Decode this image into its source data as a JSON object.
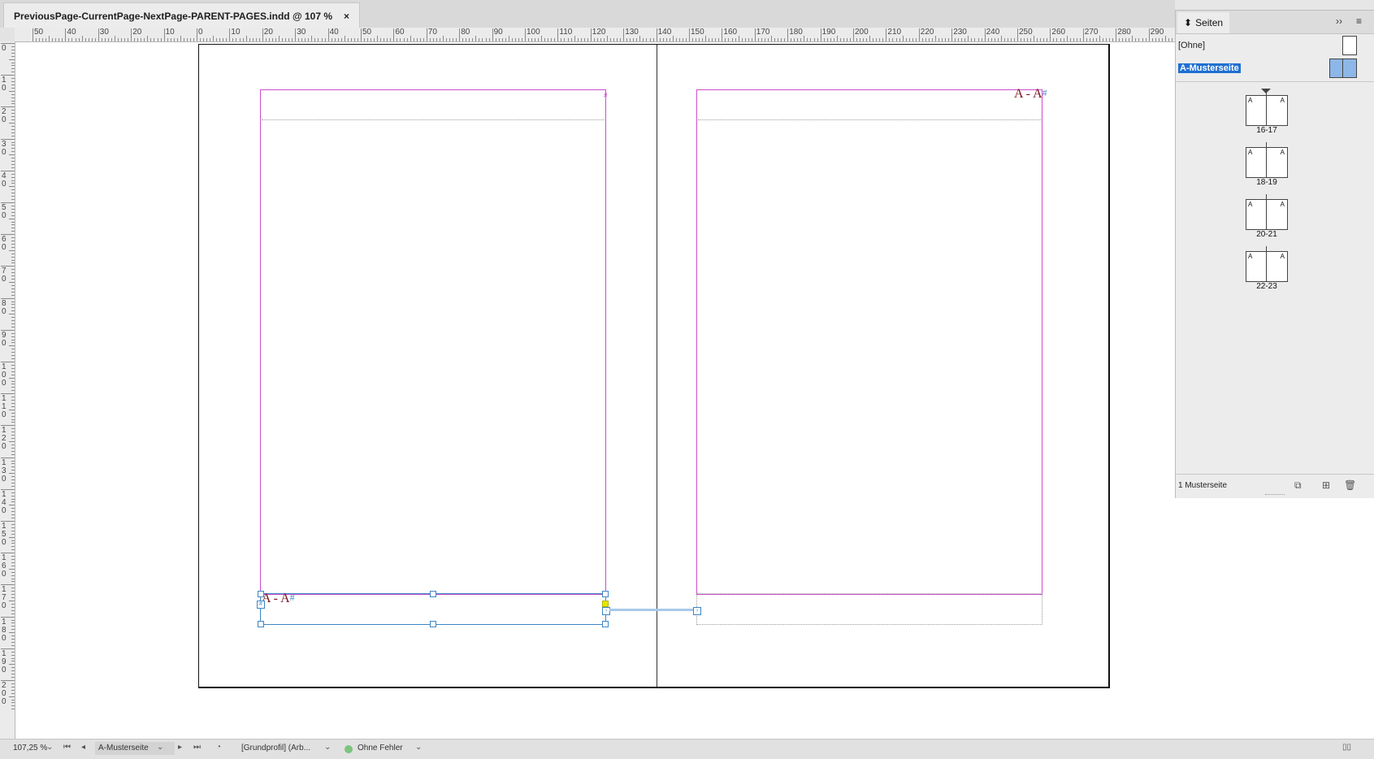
{
  "document_tab": {
    "title": "PreviousPage-CurrentPage-NextPage-PARENT-PAGES.indd @ 107 %",
    "close_glyph": "×"
  },
  "ruler_h_labels": [
    "50",
    "40",
    "30",
    "20",
    "10",
    "0",
    "10",
    "20",
    "30",
    "40",
    "50",
    "60",
    "70",
    "80",
    "90",
    "100",
    "110",
    "120",
    "130",
    "140",
    "150",
    "160",
    "170",
    "180",
    "190",
    "200",
    "210",
    "220",
    "230",
    "240",
    "250",
    "260",
    "270",
    "280",
    "290"
  ],
  "ruler_v_labels": [
    "0",
    "10",
    "20",
    "30",
    "40",
    "50",
    "60",
    "70",
    "80",
    "90",
    "100",
    "110",
    "120",
    "130",
    "140",
    "150",
    "160",
    "170",
    "180",
    "190",
    "200"
  ],
  "spread": {
    "left_page_number": "A - A",
    "right_page_number": "A - A",
    "hash": "#",
    "frame_port_glyph": "#"
  },
  "panel": {
    "title": "Seiten",
    "collapse_glyph": "››",
    "menu_glyph": "≡",
    "masters": [
      {
        "label": "[Ohne]",
        "selected": false
      },
      {
        "label": "A-Musterseite",
        "selected": true
      }
    ],
    "spreads": [
      {
        "label": "16-17",
        "left": "A",
        "right": "A"
      },
      {
        "label": "18-19",
        "left": "A",
        "right": "A"
      },
      {
        "label": "20-21",
        "left": "A",
        "right": "A"
      },
      {
        "label": "22-23",
        "left": "A",
        "right": "A"
      }
    ],
    "footer_label": "1 Musterseite",
    "footer_icons": [
      "page-size-icon",
      "new-page-icon",
      "trash-icon"
    ]
  },
  "statusbar": {
    "zoom": "107,25 %",
    "page_field": "A-Musterseite",
    "profile": "[Grundprofil] (Arb...",
    "preflight": "Ohne Fehler"
  },
  "colors": {
    "margin": "#cc4dcc",
    "selection": "#3d86c6",
    "master_selected": "#1f6fd1",
    "preflight_ok": "#7bc47f"
  }
}
